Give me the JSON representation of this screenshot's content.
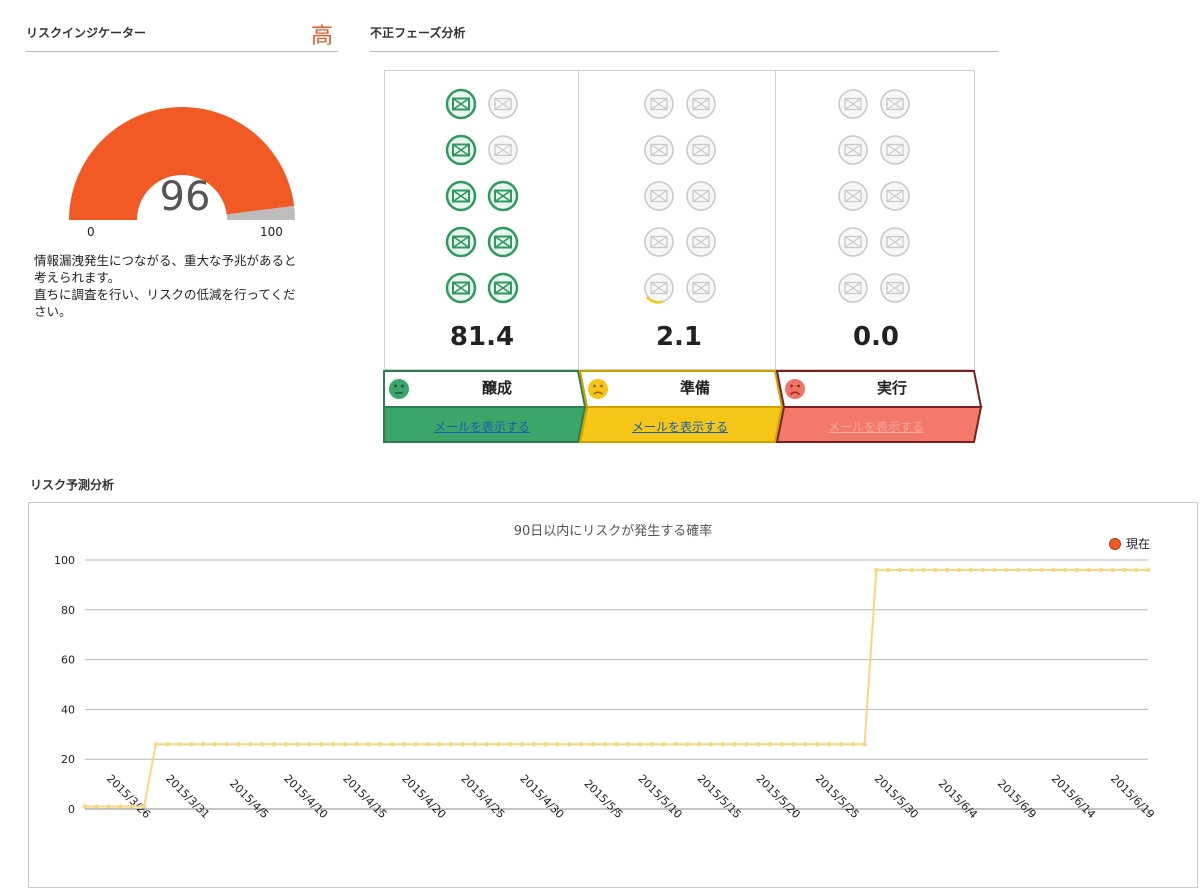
{
  "risk_indicator": {
    "title": "リスクインジケーター",
    "level": "高",
    "gauge_value": 96,
    "gauge_min_label": "0",
    "gauge_max_label": "100",
    "message": [
      "情報漏洩発生につながる、重大な予兆があると",
      "考えられます。",
      "直ちに調査を行い、リスクの低減を行ってくだ",
      "さい。"
    ],
    "gauge_color": "#f15a24",
    "gauge_rest_color": "#bdbdbd"
  },
  "phase_analysis": {
    "title": "不正フェーズ分析",
    "phases": [
      {
        "name": "醸成",
        "score": "81.4",
        "link": "メールを表示する",
        "color": "#3aa66a",
        "score_color": "#3aa66a",
        "face": "neutral-face-icon",
        "link_active": true
      },
      {
        "name": "準備",
        "score": "2.1",
        "link": "メールを表示する",
        "color": "#f5c518",
        "score_color": "#f5c518",
        "face": "worried-face-icon",
        "link_active": true
      },
      {
        "name": "実行",
        "score": "0.0",
        "link": "メールを表示する",
        "color": "#ef7466",
        "score_color": "#ef7466",
        "face": "sad-face-icon",
        "link_active": false
      }
    ],
    "icon_states": [
      [
        "on",
        "off",
        "on",
        "off",
        "on",
        "on",
        "on",
        "on",
        "on",
        "on"
      ],
      [
        "off",
        "off",
        "off",
        "off",
        "off",
        "off",
        "off",
        "off",
        "partial",
        "off"
      ],
      [
        "off",
        "off",
        "off",
        "off",
        "off",
        "off",
        "off",
        "off",
        "off",
        "off"
      ]
    ]
  },
  "risk_forecast": {
    "title": "リスク予測分析"
  },
  "chart_data": {
    "type": "line",
    "title": "90日以内にリスクが発生する確率",
    "legend": [
      {
        "name": "現在",
        "color": "#f15a24"
      }
    ],
    "legend_placement": "top-right",
    "series_color": "#f8d77e",
    "ylim": [
      0,
      100
    ],
    "yticks": [
      0,
      20,
      40,
      60,
      80,
      100
    ],
    "xticks": [
      "2015/3/26",
      "2015/3/31",
      "2015/4/5",
      "2015/4/10",
      "2015/4/15",
      "2015/4/20",
      "2015/4/25",
      "2015/4/30",
      "2015/5/5",
      "2015/5/10",
      "2015/5/15",
      "2015/5/20",
      "2015/5/25",
      "2015/5/30",
      "2015/6/4",
      "2015/6/9",
      "2015/6/14",
      "2015/6/19"
    ],
    "x_start": "2015/3/21",
    "x_end": "2015/6/19",
    "segments": [
      {
        "from": "2015/3/21",
        "to": "2015/3/26",
        "value": 1
      },
      {
        "from": "2015/3/27",
        "to": "2015/5/26",
        "value": 26
      },
      {
        "from": "2015/5/27",
        "to": "2015/6/19",
        "value": 96
      }
    ],
    "grid": true
  }
}
